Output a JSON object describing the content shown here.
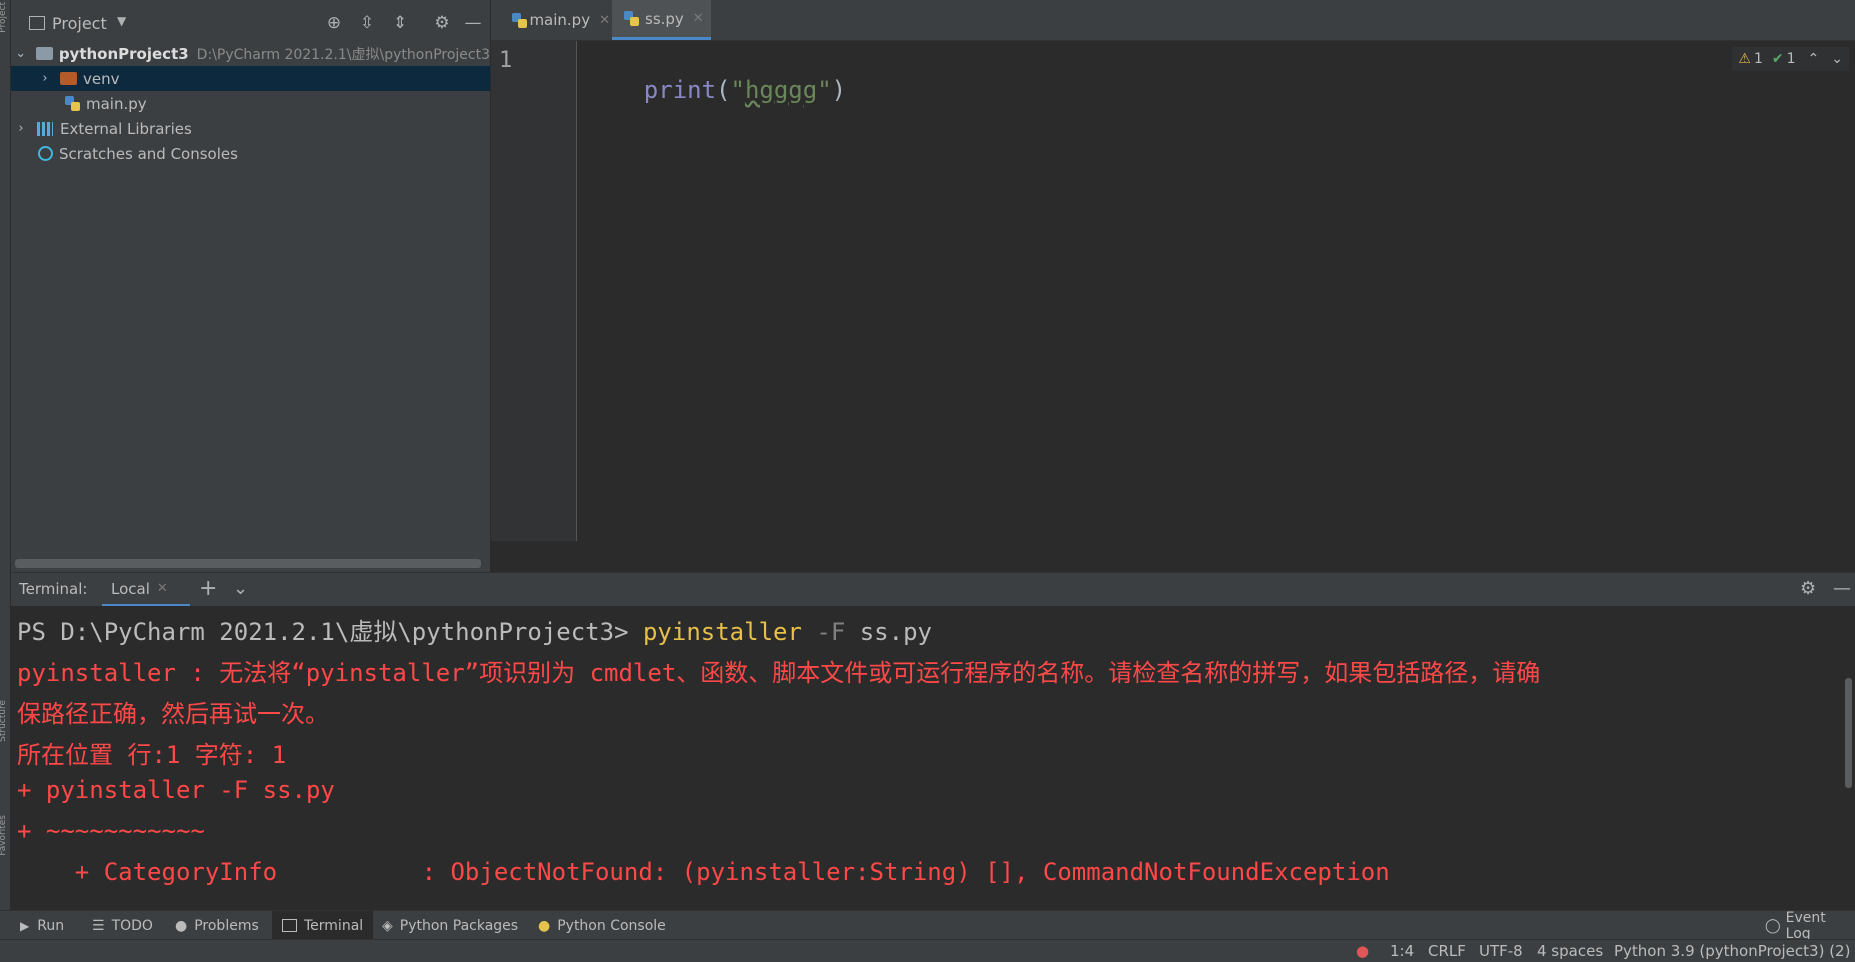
{
  "sidebar": {
    "strip_labels": [
      "Project",
      "Structure",
      "Favorites"
    ]
  },
  "project_panel": {
    "title": "Project",
    "tree": {
      "root_name": "pythonProject3",
      "root_path": "D:\\PyCharm 2021.2.1\\虚拟\\pythonProject3",
      "venv": "venv",
      "main_file": "main.py",
      "external_libraries": "External Libraries",
      "scratches": "Scratches and Consoles"
    }
  },
  "editor": {
    "tabs": [
      {
        "label": "main.py",
        "active": false
      },
      {
        "label": "ss.py",
        "active": true
      }
    ],
    "line_number": "1",
    "code": {
      "fn": "print",
      "open": "(",
      "quote_open": "\"",
      "str": "hgggg",
      "quote_close": "\"",
      "close": ")"
    },
    "inspections": {
      "warnings": "1",
      "ok": "1"
    }
  },
  "terminal": {
    "label": "Terminal:",
    "tab_local": "Local",
    "prompt": "PS D:\\PyCharm 2021.2.1\\虚拟\\pythonProject3> ",
    "cmd_name": "pyinstaller",
    "cmd_flag": " -F",
    "cmd_arg": " ss.py",
    "error_lines": [
      "pyinstaller : 无法将“pyinstaller”项识别为 cmdlet、函数、脚本文件或可运行程序的名称。请检查名称的拼写，如果包括路径，请确",
      "保路径正确，然后再试一次。",
      "所在位置 行:1 字符: 1",
      "+ pyinstaller -F ss.py",
      "+ ~~~~~~~~~~~",
      "    + CategoryInfo          : ObjectNotFound: (pyinstaller:String) [], CommandNotFoundException"
    ]
  },
  "tool_windows": {
    "run": "Run",
    "todo": "TODO",
    "problems": "Problems",
    "terminal": "Terminal",
    "python_packages": "Python Packages",
    "python_console": "Python Console",
    "event_log": "Event Log"
  },
  "status_bar": {
    "position": "1:4",
    "line_sep": "CRLF",
    "encoding": "UTF-8",
    "indent": "4 spaces",
    "interpreter": "Python 3.9 (pythonProject3) (2)"
  },
  "colors": {
    "error_red": "#ff4848",
    "keyword_purple": "#8888c6",
    "string_green": "#6a8759",
    "accent_blue": "#4a88c7"
  }
}
